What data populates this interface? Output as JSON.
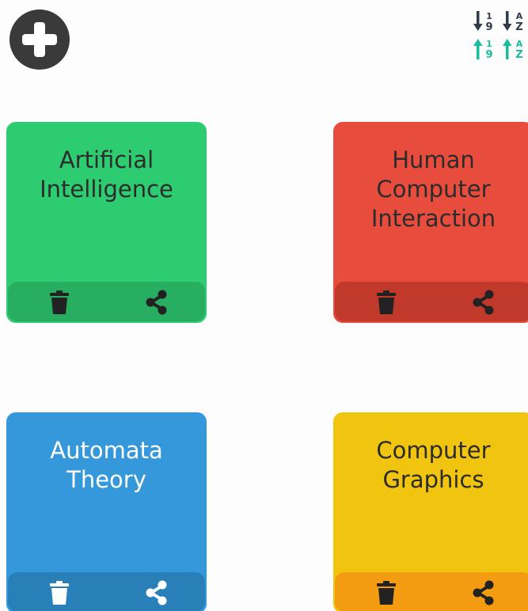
{
  "toolbar": {
    "add_icon": "plus-circle-icon",
    "sort_icons": [
      {
        "name": "sort-numeric-desc-icon",
        "digits_top": "1",
        "digits_bottom": "9",
        "color": "#2f3a4a"
      },
      {
        "name": "sort-alpha-desc-icon",
        "letters_top": "A",
        "letters_bottom": "Z",
        "color": "#2f3a4a"
      },
      {
        "name": "sort-numeric-asc-icon",
        "digits_top": "1",
        "digits_bottom": "9",
        "color": "#1abc9c"
      },
      {
        "name": "sort-alpha-asc-icon",
        "letters_top": "A",
        "letters_bottom": "Z",
        "color": "#1abc9c"
      }
    ]
  },
  "cards": [
    {
      "title": "Artificial Intelligence",
      "color": "#2ecc71",
      "footer_color": "#27ae60",
      "title_color": "#2c2c2c",
      "icon_color": "#222222"
    },
    {
      "title": "Human Computer Interaction",
      "color": "#e74c3c",
      "footer_color": "#c0392b",
      "title_color": "#2c2c2c",
      "icon_color": "#222222"
    },
    {
      "title": "Automata Theory",
      "color": "#3498db",
      "footer_color": "#2980b9",
      "title_color": "#ffffff",
      "icon_color": "#ffffff"
    },
    {
      "title": "Computer Graphics",
      "color": "#f1c40f",
      "footer_color": "#f39c12",
      "title_color": "#2c2c2c",
      "icon_color": "#222222"
    }
  ]
}
